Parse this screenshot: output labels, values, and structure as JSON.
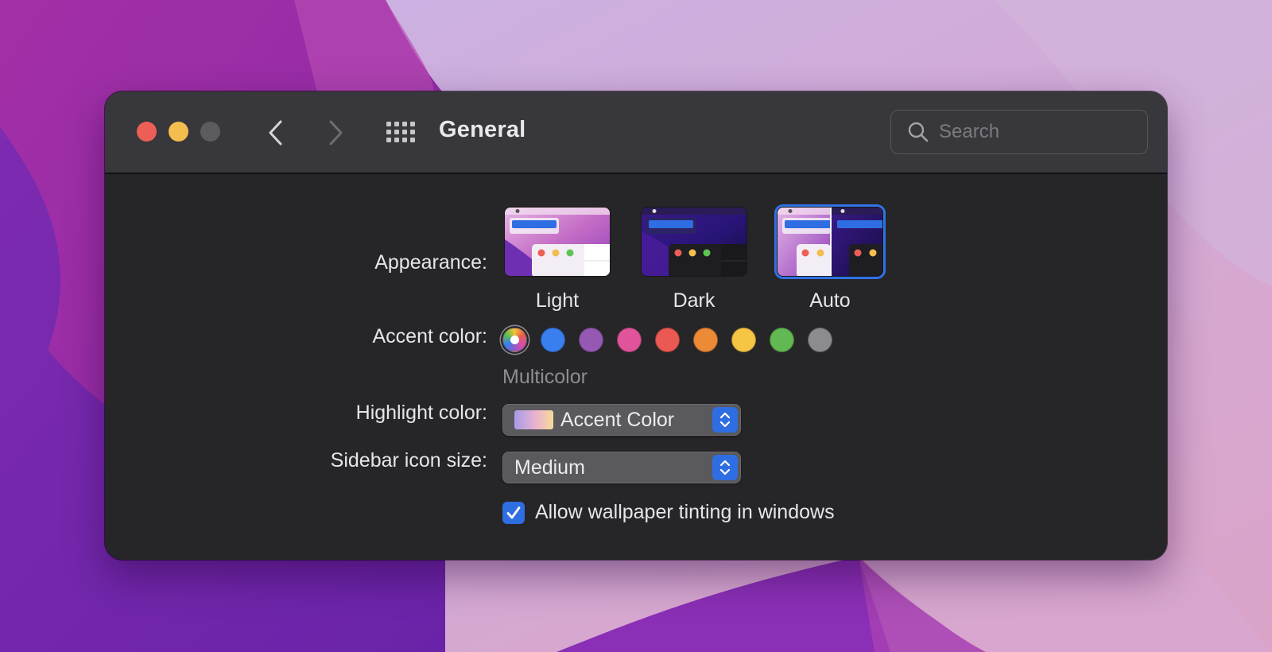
{
  "window": {
    "title": "General",
    "search_placeholder": "Search"
  },
  "icons": {
    "close": "close-button",
    "minimize": "minimize-button",
    "zoom": "zoom-button",
    "back": "chevron-left-icon",
    "forward": "chevron-right-icon",
    "show_all": "grid-icon",
    "search": "magnifier-icon"
  },
  "appearance": {
    "label": "Appearance:",
    "options": [
      {
        "name": "Light",
        "selected": false
      },
      {
        "name": "Dark",
        "selected": false
      },
      {
        "name": "Auto",
        "selected": true
      }
    ]
  },
  "accent": {
    "label": "Accent color:",
    "selected_name": "Multicolor",
    "colors": [
      "multicolor",
      "#3a7ff0",
      "#9659b3",
      "#e0549c",
      "#ea5a52",
      "#ec8a36",
      "#f5c543",
      "#62b852",
      "#8c8c8e"
    ]
  },
  "highlight": {
    "label": "Highlight color:",
    "value": "Accent Color"
  },
  "sidebar_icon_size": {
    "label": "Sidebar icon size:",
    "value": "Medium"
  },
  "wallpaper_tinting": {
    "label": "Allow wallpaper tinting in windows",
    "checked": true
  },
  "colors": {
    "accent_blue": "#2f6ee2",
    "window_bg": "#262528",
    "titlebar_bg": "#38373b"
  }
}
